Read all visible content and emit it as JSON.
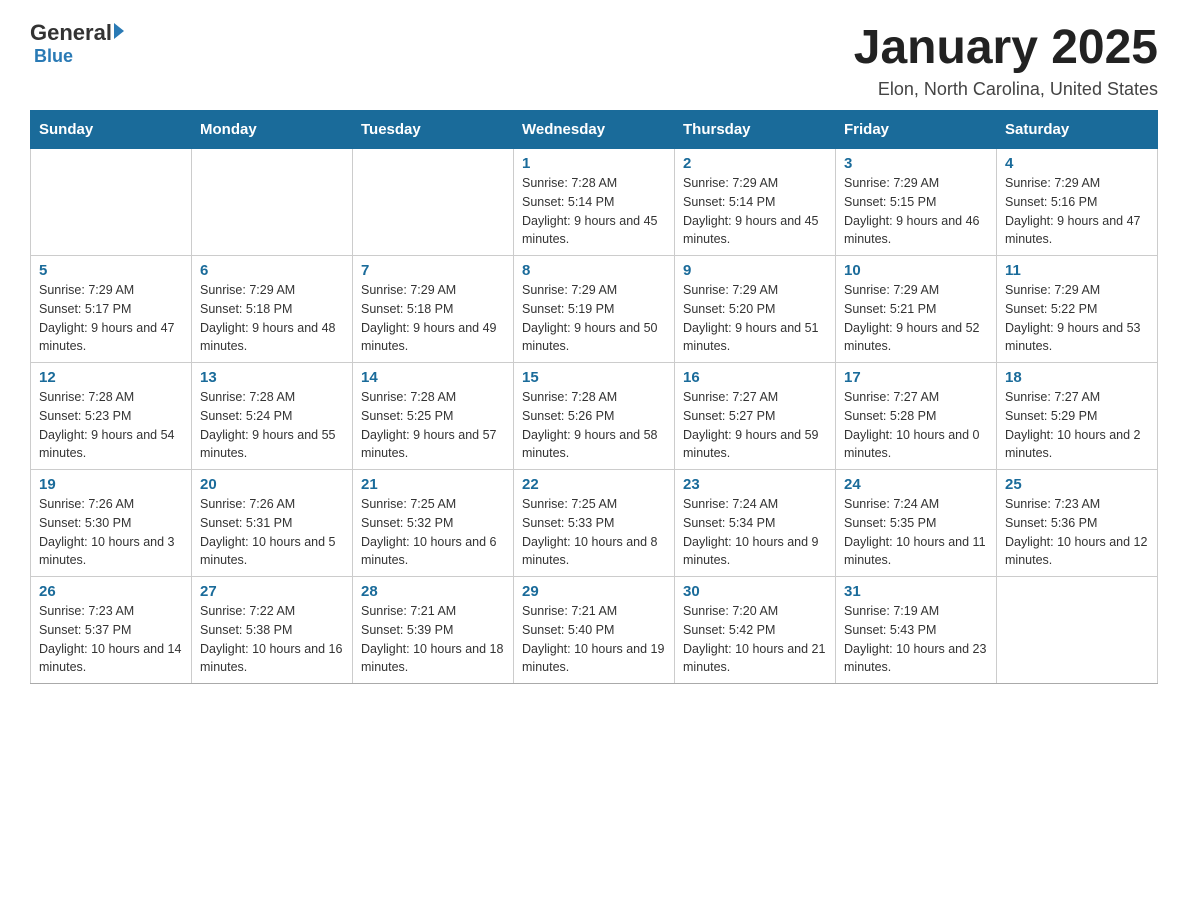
{
  "header": {
    "logo_text_general": "General",
    "logo_text_blue": "Blue",
    "title": "January 2025",
    "subtitle": "Elon, North Carolina, United States"
  },
  "days_of_week": [
    "Sunday",
    "Monday",
    "Tuesday",
    "Wednesday",
    "Thursday",
    "Friday",
    "Saturday"
  ],
  "weeks": [
    [
      {
        "day": "",
        "info": ""
      },
      {
        "day": "",
        "info": ""
      },
      {
        "day": "",
        "info": ""
      },
      {
        "day": "1",
        "info": "Sunrise: 7:28 AM\nSunset: 5:14 PM\nDaylight: 9 hours and 45 minutes."
      },
      {
        "day": "2",
        "info": "Sunrise: 7:29 AM\nSunset: 5:14 PM\nDaylight: 9 hours and 45 minutes."
      },
      {
        "day": "3",
        "info": "Sunrise: 7:29 AM\nSunset: 5:15 PM\nDaylight: 9 hours and 46 minutes."
      },
      {
        "day": "4",
        "info": "Sunrise: 7:29 AM\nSunset: 5:16 PM\nDaylight: 9 hours and 47 minutes."
      }
    ],
    [
      {
        "day": "5",
        "info": "Sunrise: 7:29 AM\nSunset: 5:17 PM\nDaylight: 9 hours and 47 minutes."
      },
      {
        "day": "6",
        "info": "Sunrise: 7:29 AM\nSunset: 5:18 PM\nDaylight: 9 hours and 48 minutes."
      },
      {
        "day": "7",
        "info": "Sunrise: 7:29 AM\nSunset: 5:18 PM\nDaylight: 9 hours and 49 minutes."
      },
      {
        "day": "8",
        "info": "Sunrise: 7:29 AM\nSunset: 5:19 PM\nDaylight: 9 hours and 50 minutes."
      },
      {
        "day": "9",
        "info": "Sunrise: 7:29 AM\nSunset: 5:20 PM\nDaylight: 9 hours and 51 minutes."
      },
      {
        "day": "10",
        "info": "Sunrise: 7:29 AM\nSunset: 5:21 PM\nDaylight: 9 hours and 52 minutes."
      },
      {
        "day": "11",
        "info": "Sunrise: 7:29 AM\nSunset: 5:22 PM\nDaylight: 9 hours and 53 minutes."
      }
    ],
    [
      {
        "day": "12",
        "info": "Sunrise: 7:28 AM\nSunset: 5:23 PM\nDaylight: 9 hours and 54 minutes."
      },
      {
        "day": "13",
        "info": "Sunrise: 7:28 AM\nSunset: 5:24 PM\nDaylight: 9 hours and 55 minutes."
      },
      {
        "day": "14",
        "info": "Sunrise: 7:28 AM\nSunset: 5:25 PM\nDaylight: 9 hours and 57 minutes."
      },
      {
        "day": "15",
        "info": "Sunrise: 7:28 AM\nSunset: 5:26 PM\nDaylight: 9 hours and 58 minutes."
      },
      {
        "day": "16",
        "info": "Sunrise: 7:27 AM\nSunset: 5:27 PM\nDaylight: 9 hours and 59 minutes."
      },
      {
        "day": "17",
        "info": "Sunrise: 7:27 AM\nSunset: 5:28 PM\nDaylight: 10 hours and 0 minutes."
      },
      {
        "day": "18",
        "info": "Sunrise: 7:27 AM\nSunset: 5:29 PM\nDaylight: 10 hours and 2 minutes."
      }
    ],
    [
      {
        "day": "19",
        "info": "Sunrise: 7:26 AM\nSunset: 5:30 PM\nDaylight: 10 hours and 3 minutes."
      },
      {
        "day": "20",
        "info": "Sunrise: 7:26 AM\nSunset: 5:31 PM\nDaylight: 10 hours and 5 minutes."
      },
      {
        "day": "21",
        "info": "Sunrise: 7:25 AM\nSunset: 5:32 PM\nDaylight: 10 hours and 6 minutes."
      },
      {
        "day": "22",
        "info": "Sunrise: 7:25 AM\nSunset: 5:33 PM\nDaylight: 10 hours and 8 minutes."
      },
      {
        "day": "23",
        "info": "Sunrise: 7:24 AM\nSunset: 5:34 PM\nDaylight: 10 hours and 9 minutes."
      },
      {
        "day": "24",
        "info": "Sunrise: 7:24 AM\nSunset: 5:35 PM\nDaylight: 10 hours and 11 minutes."
      },
      {
        "day": "25",
        "info": "Sunrise: 7:23 AM\nSunset: 5:36 PM\nDaylight: 10 hours and 12 minutes."
      }
    ],
    [
      {
        "day": "26",
        "info": "Sunrise: 7:23 AM\nSunset: 5:37 PM\nDaylight: 10 hours and 14 minutes."
      },
      {
        "day": "27",
        "info": "Sunrise: 7:22 AM\nSunset: 5:38 PM\nDaylight: 10 hours and 16 minutes."
      },
      {
        "day": "28",
        "info": "Sunrise: 7:21 AM\nSunset: 5:39 PM\nDaylight: 10 hours and 18 minutes."
      },
      {
        "day": "29",
        "info": "Sunrise: 7:21 AM\nSunset: 5:40 PM\nDaylight: 10 hours and 19 minutes."
      },
      {
        "day": "30",
        "info": "Sunrise: 7:20 AM\nSunset: 5:42 PM\nDaylight: 10 hours and 21 minutes."
      },
      {
        "day": "31",
        "info": "Sunrise: 7:19 AM\nSunset: 5:43 PM\nDaylight: 10 hours and 23 minutes."
      },
      {
        "day": "",
        "info": ""
      }
    ]
  ]
}
